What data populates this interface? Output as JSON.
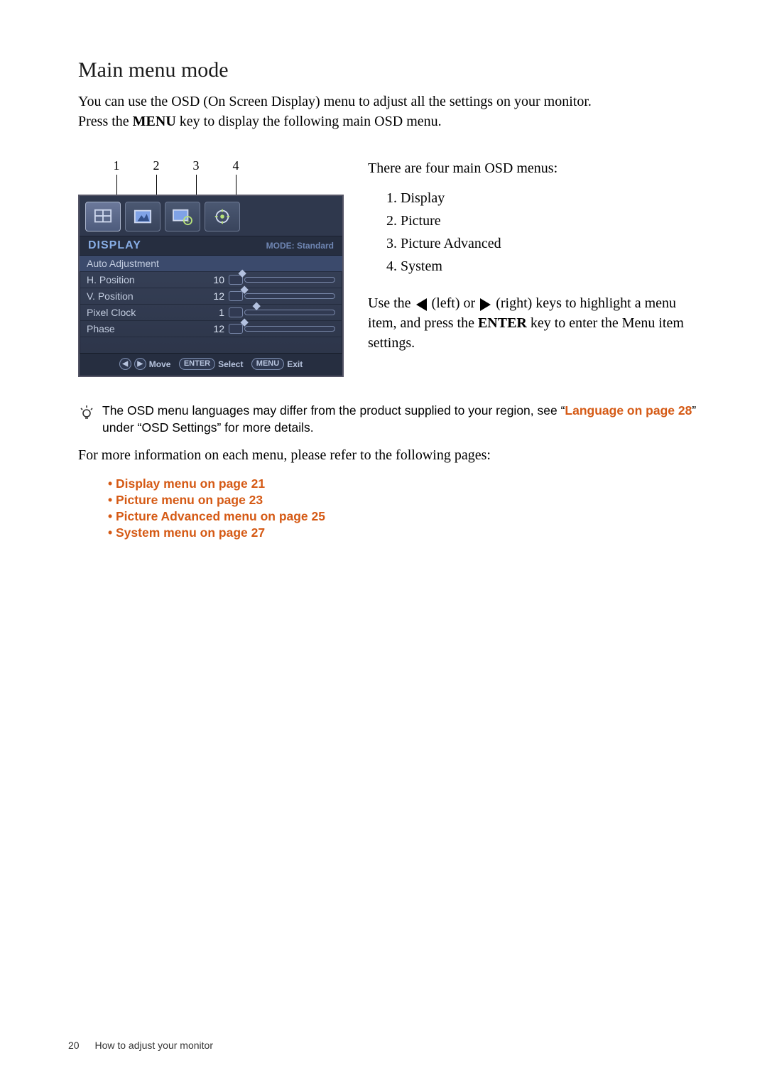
{
  "title": "Main menu mode",
  "intro": {
    "line1": "You can use the OSD (On Screen Display) menu to adjust all the settings on your monitor.",
    "line2a": "Press the ",
    "menu_key": "MENU",
    "line2b": " key to display the following main OSD menu."
  },
  "callouts": [
    "1",
    "2",
    "3",
    "4"
  ],
  "osd": {
    "header_title": "DISPLAY",
    "header_mode": "MODE: Standard",
    "rows": [
      {
        "label": "Auto Adjustment",
        "value": "",
        "slider": false
      },
      {
        "label": "H. Position",
        "value": "10",
        "slider": true
      },
      {
        "label": "V. Position",
        "value": "12",
        "slider": true
      },
      {
        "label": "Pixel Clock",
        "value": "1",
        "slider": true
      },
      {
        "label": "Phase",
        "value": "12",
        "slider": true
      }
    ],
    "footer": {
      "move": "Move",
      "enter": "ENTER",
      "select": "Select",
      "menu": "MENU",
      "exit": "Exit"
    },
    "tab_icons": [
      "display-icon",
      "picture-icon",
      "picture-adv-icon",
      "system-icon"
    ]
  },
  "right": {
    "lead": "There are four main OSD menus:",
    "items": [
      "Display",
      "Picture",
      "Picture Advanced",
      "System"
    ],
    "use_a": "Use the ",
    "use_left": " (left) or ",
    "use_right": " (right) keys to high­light a menu item, and press the ",
    "enter_key": "ENTER",
    "use_tail": " key to enter the Menu item settings."
  },
  "tip": {
    "text_a": "The OSD menu languages may differ from the product supplied to your region, see “",
    "link": "Language on page 28",
    "text_b": "” under “OSD Settings” for more details."
  },
  "aftertip": "For more information on each menu, please refer to the following pages:",
  "bullets": [
    "Display menu on page 21",
    "Picture menu on page 23",
    "Picture Advanced menu on page 25",
    "System menu on page 27"
  ],
  "footer": {
    "page": "20",
    "section": "How to adjust your monitor"
  }
}
